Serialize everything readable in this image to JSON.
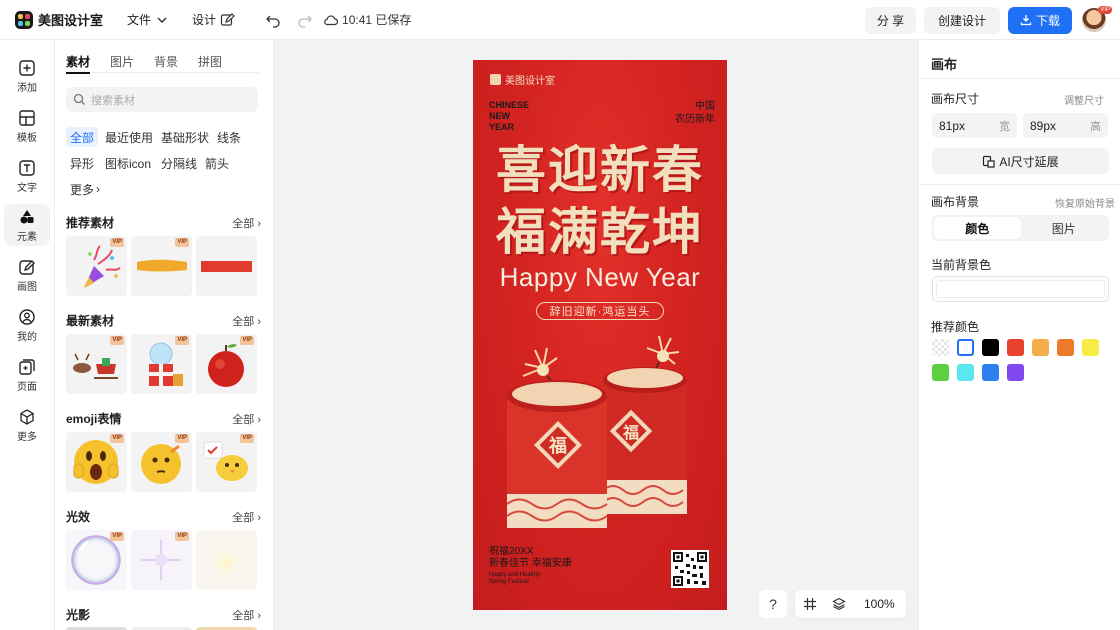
{
  "app": {
    "name": "美图设计室"
  },
  "topbar": {
    "menu_file": "文件",
    "menu_design": "设计",
    "save_status": "10:41 已保存",
    "share_label": "分 享",
    "create_label": "创建设计",
    "download_label": "下载",
    "avatar_badge": "VIP"
  },
  "rail": {
    "items": [
      {
        "label": "添加",
        "icon": "plus-square-icon"
      },
      {
        "label": "模板",
        "icon": "template-icon"
      },
      {
        "label": "文字",
        "icon": "text-icon"
      },
      {
        "label": "元素",
        "icon": "shapes-icon"
      },
      {
        "label": "画图",
        "icon": "pencil-icon"
      },
      {
        "label": "我的",
        "icon": "user-icon"
      },
      {
        "label": "页面",
        "icon": "page-add-icon"
      },
      {
        "label": "更多",
        "icon": "cube-icon"
      }
    ]
  },
  "panel": {
    "tabs": [
      "素材",
      "图片",
      "背景",
      "拼图"
    ],
    "search_placeholder": "搜索素材",
    "chips": [
      "全部",
      "最近使用",
      "基础形状",
      "线条",
      "异形",
      "图标icon",
      "分隔线",
      "箭头",
      "更多"
    ],
    "vip_tag": "VIP",
    "all_label": "全部",
    "sections": [
      "推荐素材",
      "最新素材",
      "emoji表情",
      "光效",
      "光影"
    ]
  },
  "poster": {
    "brand": "美图设计室",
    "en_lines": [
      "CHINESE",
      "NEW",
      "YEAR"
    ],
    "cn_lines": [
      "中国",
      "农历新年"
    ],
    "title_line1": "喜迎新春",
    "title_line2": "福满乾坤",
    "happy": "Happy New Year",
    "slogan": "辞旧迎新·鸿运当头",
    "fu": "福",
    "foot_line1": "祝福20XX",
    "foot_line2": "新春佳节 幸福安康",
    "foot_en1": "Happy and Healthy",
    "foot_en2": "Spring Festival"
  },
  "canvas_tools": {
    "help": "?",
    "zoom": "100%"
  },
  "right_panel": {
    "title": "画布",
    "size_label": "画布尺寸",
    "adjust_size": "调整尺寸",
    "width_value": "81px",
    "width_unit": "宽",
    "height_value": "89px",
    "height_unit": "高",
    "ai_extend": "AI尺寸延展",
    "bg_label": "画布背景",
    "restore_bg": "恢复原始背景",
    "seg_color": "颜色",
    "seg_image": "图片",
    "current_bg": "当前背景色",
    "recommend": "推荐颜色",
    "swatches": [
      "#ffffff",
      "#000000",
      "#e8412e",
      "#f5ac4b",
      "#ef7a2a",
      "#f7ec45",
      "#5ccf43",
      "#5be7f0",
      "#2f7ff0",
      "#8248f0"
    ]
  }
}
